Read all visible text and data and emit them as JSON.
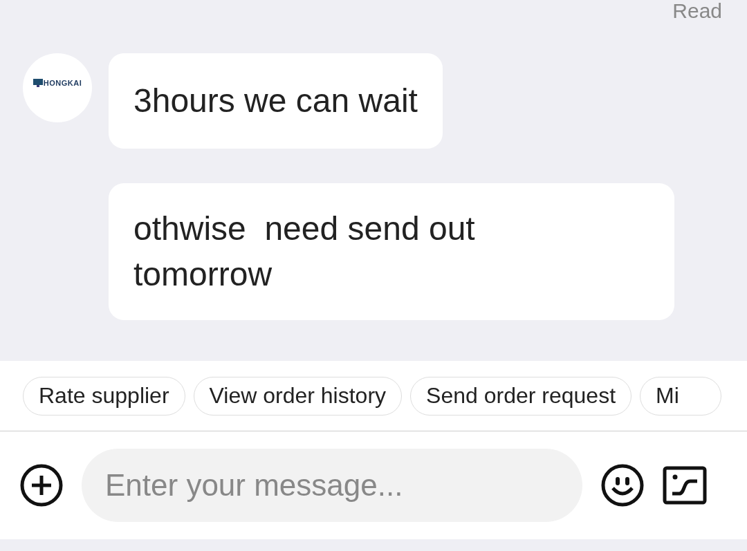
{
  "status": "Read",
  "messages": [
    {
      "avatar": "HONGKAI",
      "text": "3hours we can wait"
    },
    {
      "text": "othwise  need send out tomorrow"
    }
  ],
  "quick_replies": [
    "Rate supplier",
    "View order history",
    "Send order request",
    "Mi"
  ],
  "composer": {
    "placeholder": "Enter your message..."
  }
}
